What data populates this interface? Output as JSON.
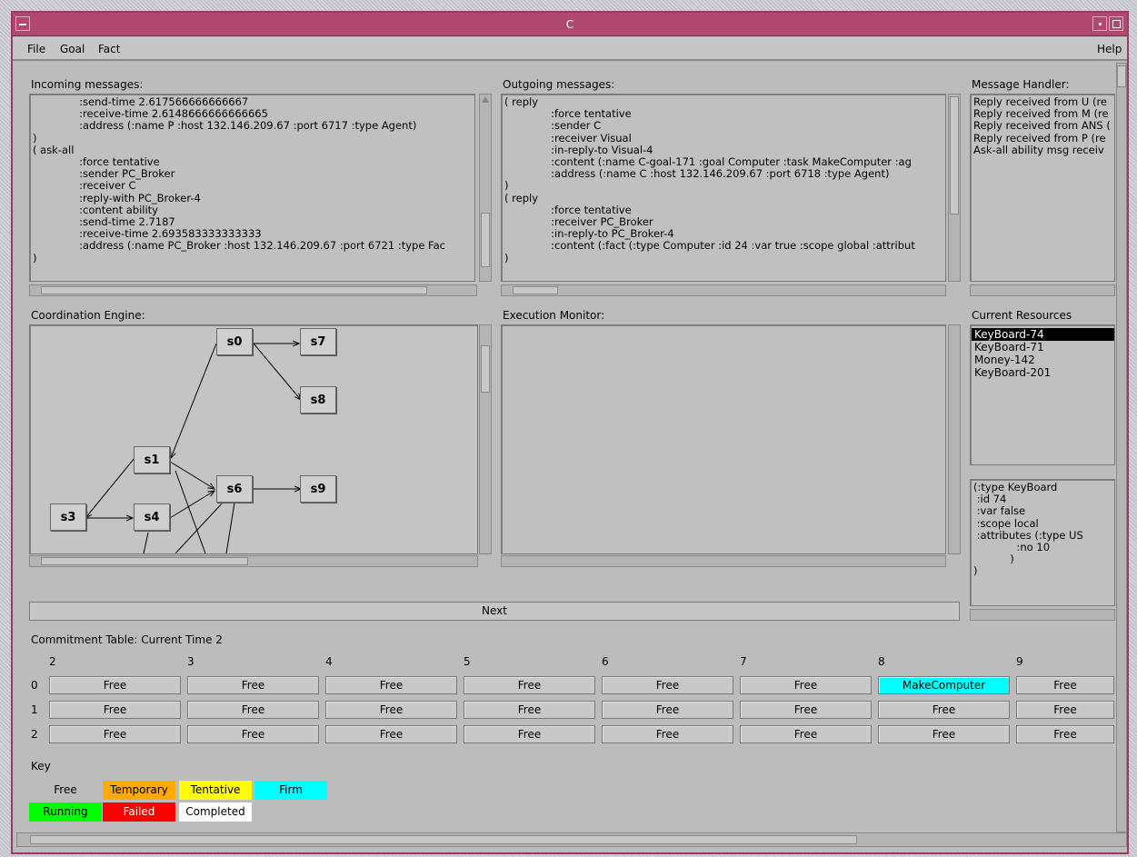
{
  "window": {
    "title": "C"
  },
  "menu": {
    "file": "File",
    "goal": "Goal",
    "fact": "Fact",
    "help": "Help"
  },
  "incoming": {
    "label": "Incoming messages:",
    "text": "              :send-time 2.617566666666667\n              :receive-time 2.6148666666666665\n              :address (:name P :host 132.146.209.67 :port 6717 :type Agent)\n)\n( ask-all\n              :force tentative\n              :sender PC_Broker\n              :receiver C\n              :reply-with PC_Broker-4\n              :content ability\n              :send-time 2.7187\n              :receive-time 2.693583333333333\n              :address (:name PC_Broker :host 132.146.209.67 :port 6721 :type Fac\n)"
  },
  "outgoing": {
    "label": "Outgoing messages:",
    "text": "( reply\n              :force tentative\n              :sender C\n              :receiver Visual\n              :in-reply-to Visual-4\n              :content (:name C-goal-171 :goal Computer :task MakeComputer :ag\n              :address (:name C :host 132.146.209.67 :port 6718 :type Agent)\n)\n( reply\n              :force tentative\n              :receiver PC_Broker\n              :in-reply-to PC_Broker-4\n              :content (:fact (:type Computer :id 24 :var true :scope global :attribut\n)"
  },
  "handler": {
    "label": "Message Handler:",
    "text": "Reply received from U (re\nReply received from M (re\nReply received from ANS (\nReply received from P (re\nAsk-all ability msg receiv"
  },
  "coordination": {
    "label": "Coordination Engine:",
    "nodes": [
      "s0",
      "s7",
      "s8",
      "s1",
      "s6",
      "s9",
      "s3",
      "s4"
    ]
  },
  "execution": {
    "label": "Execution Monitor:"
  },
  "resources": {
    "label": "Current Resources",
    "items": [
      "KeyBoard-74",
      "KeyBoard-71",
      "Money-142",
      "KeyBoard-201"
    ],
    "detail": "(:type KeyBoard\n :id 74\n :var false\n :scope local\n :attributes (:type US\n             :no 10\n           )\n)"
  },
  "next_label": "Next",
  "commitment": {
    "label": "Commitment Table: Current Time 2",
    "times": [
      "2",
      "3",
      "4",
      "5",
      "6",
      "7",
      "8",
      "9"
    ],
    "rows": [
      {
        "id": "0",
        "cells": [
          "Free",
          "Free",
          "Free",
          "Free",
          "Free",
          "Free",
          "MakeComputer",
          "Free"
        ]
      },
      {
        "id": "1",
        "cells": [
          "Free",
          "Free",
          "Free",
          "Free",
          "Free",
          "Free",
          "Free",
          "Free"
        ]
      },
      {
        "id": "2",
        "cells": [
          "Free",
          "Free",
          "Free",
          "Free",
          "Free",
          "Free",
          "Free",
          "Free"
        ]
      }
    ]
  },
  "key": {
    "label": "Key",
    "items": [
      {
        "label": "Free",
        "color": "#bcbcbc",
        "text_color": "#000000"
      },
      {
        "label": "Temporary",
        "color": "#ffaa00",
        "text_color": "#000000"
      },
      {
        "label": "Tentative",
        "color": "#ffff00",
        "text_color": "#000000"
      },
      {
        "label": "Firm",
        "color": "#00ffff",
        "text_color": "#000000"
      },
      {
        "label": "Running",
        "color": "#00ff00",
        "text_color": "#000000"
      },
      {
        "label": "Failed",
        "color": "#ff0000",
        "text_color": "#ffffff"
      },
      {
        "label": "Completed",
        "color": "#ffffff",
        "text_color": "#000000"
      }
    ]
  },
  "colors": {
    "title_bar": "#b0486f",
    "firm": "#00ffff"
  }
}
